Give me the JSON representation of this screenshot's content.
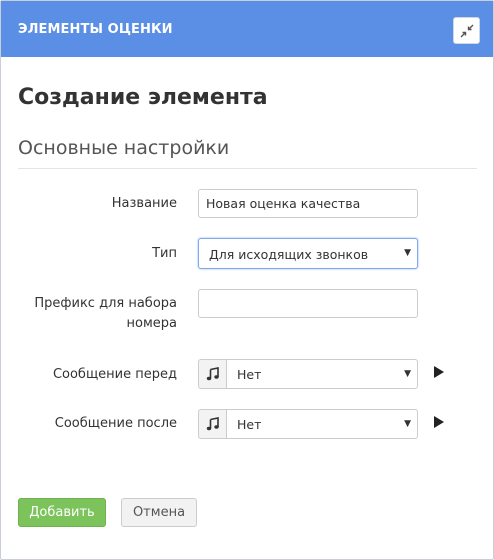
{
  "header": {
    "title": "ЭЛЕМЕНТЫ ОЦЕНКИ",
    "collapse_icon": "collapse-arrows-icon",
    "color": "#5b8fe6"
  },
  "page": {
    "title": "Создание элемента",
    "section": "Основные настройки"
  },
  "form": {
    "name": {
      "label": "Название",
      "value": "Новая оценка качества"
    },
    "type": {
      "label": "Тип",
      "value": "Для исходящих звонков"
    },
    "prefix": {
      "label_line1": "Префикс для набора",
      "label_line2": "номера",
      "value": ""
    },
    "message_before": {
      "label": "Сообщение перед",
      "value": "Нет",
      "icon": "music-note-icon",
      "play_icon": "play-icon"
    },
    "message_after": {
      "label": "Сообщение после",
      "value": "Нет",
      "icon": "music-note-icon",
      "play_icon": "play-icon"
    }
  },
  "actions": {
    "add_label": "Добавить",
    "cancel_label": "Отмена",
    "add_color": "#7dc35b"
  }
}
